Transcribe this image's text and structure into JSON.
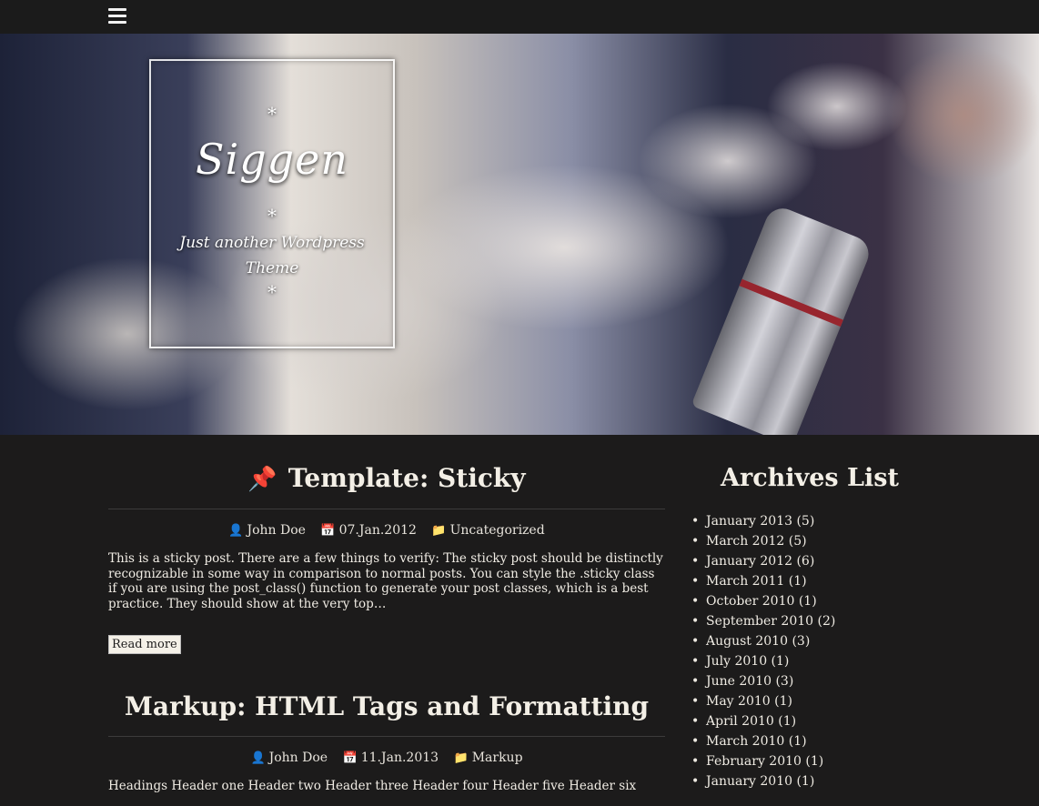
{
  "site": {
    "title": "Siggen",
    "description": "Just another Wordpress Theme",
    "star": "*"
  },
  "posts": [
    {
      "title": "Template: Sticky",
      "author": "John Doe",
      "date": "07.Jan.2012",
      "category": "Uncategorized",
      "excerpt": "This is a sticky post. There are a few things to verify: The sticky post should be distinctly recognizable in some way in comparison to normal posts. You can style the .sticky class if you are using the post_class() function to generate your post classes, which is a best practice. They should show at the very top…",
      "read_more": "Read more"
    },
    {
      "title": "Markup: HTML Tags and Formatting",
      "author": "John Doe",
      "date": "11.Jan.2013",
      "category": "Markup",
      "excerpt": "Headings Header one Header two Header three Header four Header five Header six"
    }
  ],
  "sidebar": {
    "title": "Archives List",
    "archives": [
      "January 2013 (5)",
      "March 2012 (5)",
      "January 2012 (6)",
      "March 2011 (1)",
      "October 2010 (1)",
      "September 2010 (2)",
      "August 2010 (3)",
      "July 2010 (1)",
      "June 2010 (3)",
      "May 2010 (1)",
      "April 2010 (1)",
      "March 2010 (1)",
      "February 2010 (1)",
      "January 2010 (1)"
    ]
  },
  "icons": {
    "menu": "menu-icon",
    "pin": "thumbtack-icon",
    "user": "user-icon",
    "calendar": "calendar-icon",
    "folder": "folder-icon"
  }
}
